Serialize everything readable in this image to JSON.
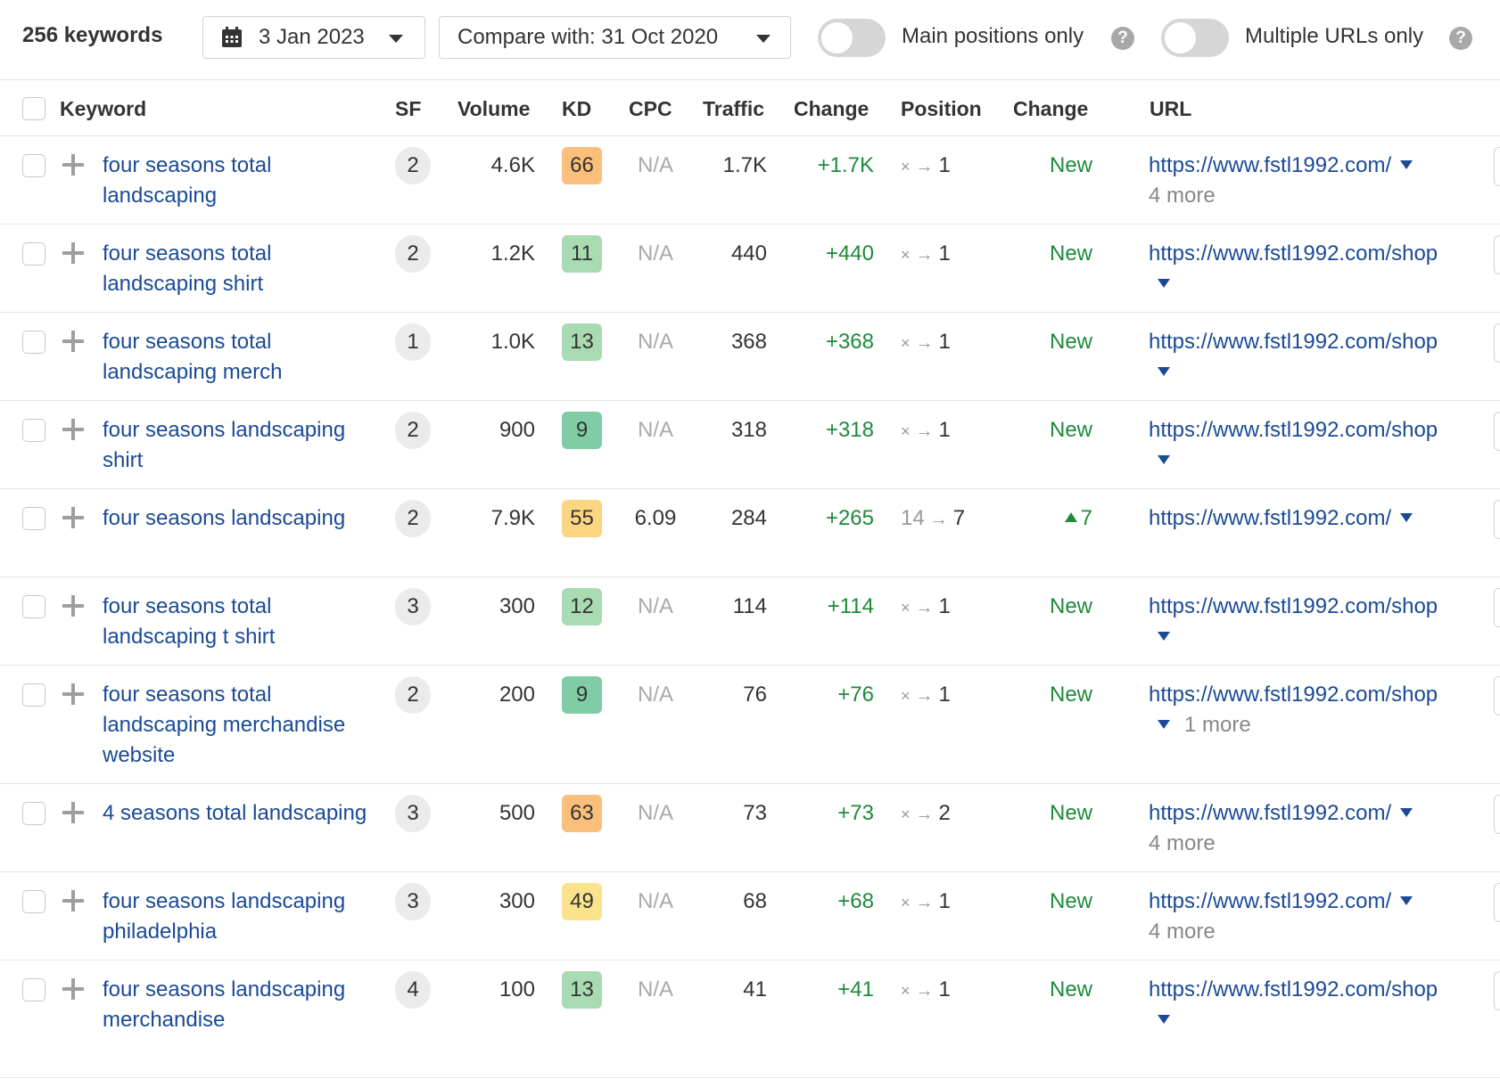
{
  "toolbar": {
    "keyword_count": "256 keywords",
    "date": "3 Jan 2023",
    "compare": "Compare with: 31 Oct 2020",
    "main_positions_label": "Main positions only",
    "main_positions_on": false,
    "multiple_urls_label": "Multiple URLs only",
    "multiple_urls_on": false,
    "help_glyph": "?"
  },
  "columns": {
    "keyword": "Keyword",
    "sf": "SF",
    "volume": "Volume",
    "kd": "KD",
    "cpc": "CPC",
    "traffic": "Traffic",
    "traffic_change": "Change",
    "position": "Position",
    "position_change": "Change",
    "url": "URL"
  },
  "colors": {
    "kd_orange": "#fbbf7c",
    "kd_yellow": "#fbe38e",
    "kd_light_green": "#a9dbb3",
    "kd_green": "#7fcca5",
    "link": "#1a4a96",
    "positive": "#1e8a3a"
  },
  "rows": [
    {
      "keyword": "four seasons total landscaping",
      "sf": "2",
      "volume": "4.6K",
      "kd": "66",
      "kd_color": "#fbbf7c",
      "cpc": "N/A",
      "traffic": "1.7K",
      "traffic_change": "+1.7K",
      "pos_from": "×",
      "pos_to": "1",
      "pos_change": "New",
      "pos_change_up": false,
      "url": "https://www.fstl1992.com/",
      "caret": "inline",
      "more": "4 more",
      "more_pos": "below"
    },
    {
      "keyword": "four seasons total landscaping shirt",
      "sf": "2",
      "volume": "1.2K",
      "kd": "11",
      "kd_color": "#a9dbb3",
      "cpc": "N/A",
      "traffic": "440",
      "traffic_change": "+440",
      "pos_from": "×",
      "pos_to": "1",
      "pos_change": "New",
      "pos_change_up": false,
      "url": "https://www.fstl1992.com/shop",
      "caret": "below",
      "more": "",
      "more_pos": ""
    },
    {
      "keyword": "four seasons total landscaping merch",
      "sf": "1",
      "volume": "1.0K",
      "kd": "13",
      "kd_color": "#a9dbb3",
      "cpc": "N/A",
      "traffic": "368",
      "traffic_change": "+368",
      "pos_from": "×",
      "pos_to": "1",
      "pos_change": "New",
      "pos_change_up": false,
      "url": "https://www.fstl1992.com/shop",
      "caret": "below",
      "more": "",
      "more_pos": ""
    },
    {
      "keyword": "four seasons landscaping shirt",
      "sf": "2",
      "volume": "900",
      "kd": "9",
      "kd_color": "#7fcca5",
      "cpc": "N/A",
      "traffic": "318",
      "traffic_change": "+318",
      "pos_from": "×",
      "pos_to": "1",
      "pos_change": "New",
      "pos_change_up": false,
      "url": "https://www.fstl1992.com/shop",
      "caret": "below",
      "more": "",
      "more_pos": ""
    },
    {
      "keyword": "four seasons landscaping",
      "sf": "2",
      "volume": "7.9K",
      "kd": "55",
      "kd_color": "#fcd581",
      "cpc": "6.09",
      "traffic": "284",
      "traffic_change": "+265",
      "pos_from": "14",
      "pos_to": "7",
      "pos_change": "7",
      "pos_change_up": true,
      "url": "https://www.fstl1992.com/",
      "caret": "inline",
      "more": "",
      "more_pos": ""
    },
    {
      "keyword": "four seasons total landscaping t shirt",
      "sf": "3",
      "volume": "300",
      "kd": "12",
      "kd_color": "#a9dbb3",
      "cpc": "N/A",
      "traffic": "114",
      "traffic_change": "+114",
      "pos_from": "×",
      "pos_to": "1",
      "pos_change": "New",
      "pos_change_up": false,
      "url": "https://www.fstl1992.com/shop",
      "caret": "below",
      "more": "",
      "more_pos": ""
    },
    {
      "keyword": "four seasons total landscaping merchandise website",
      "sf": "2",
      "volume": "200",
      "kd": "9",
      "kd_color": "#7fcca5",
      "cpc": "N/A",
      "traffic": "76",
      "traffic_change": "+76",
      "pos_from": "×",
      "pos_to": "1",
      "pos_change": "New",
      "pos_change_up": false,
      "url": "https://www.fstl1992.com/shop",
      "caret": "below",
      "more": "1 more",
      "more_pos": "after-caret"
    },
    {
      "keyword": "4 seasons total landscaping",
      "sf": "3",
      "volume": "500",
      "kd": "63",
      "kd_color": "#fbbf7c",
      "cpc": "N/A",
      "traffic": "73",
      "traffic_change": "+73",
      "pos_from": "×",
      "pos_to": "2",
      "pos_change": "New",
      "pos_change_up": false,
      "url": "https://www.fstl1992.com/",
      "caret": "inline",
      "more": "4 more",
      "more_pos": "below"
    },
    {
      "keyword": "four seasons landscaping philadelphia",
      "sf": "3",
      "volume": "300",
      "kd": "49",
      "kd_color": "#fbe38e",
      "cpc": "N/A",
      "traffic": "68",
      "traffic_change": "+68",
      "pos_from": "×",
      "pos_to": "1",
      "pos_change": "New",
      "pos_change_up": false,
      "url": "https://www.fstl1992.com/",
      "caret": "inline",
      "more": "4 more",
      "more_pos": "below"
    },
    {
      "keyword": "four seasons landscaping merchandise",
      "sf": "4",
      "volume": "100",
      "kd": "13",
      "kd_color": "#a9dbb3",
      "cpc": "N/A",
      "traffic": "41",
      "traffic_change": "+41",
      "pos_from": "×",
      "pos_to": "1",
      "pos_change": "New",
      "pos_change_up": false,
      "url": "https://www.fstl1992.com/shop",
      "caret": "below",
      "more": "",
      "more_pos": ""
    }
  ]
}
